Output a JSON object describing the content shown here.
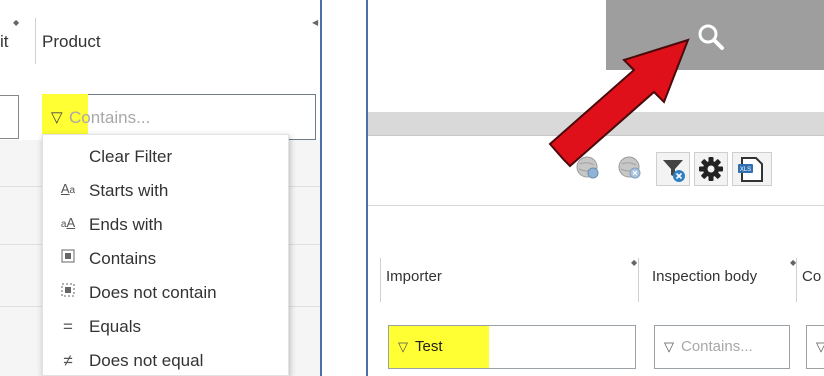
{
  "left": {
    "prev_column_label": "it",
    "column_header": "Product",
    "filter": {
      "placeholder": "Contains...",
      "funnel_icon": "filter-icon"
    },
    "menu": {
      "items": [
        {
          "label": "Clear Filter",
          "icon": ""
        },
        {
          "label": "Starts with",
          "icon": "starts-with-icon"
        },
        {
          "label": "Ends with",
          "icon": "ends-with-icon"
        },
        {
          "label": "Contains",
          "icon": "contains-icon"
        },
        {
          "label": "Does not contain",
          "icon": "does-not-contain-icon"
        },
        {
          "label": "Equals",
          "icon": "equals-icon"
        },
        {
          "label": "Does not equal",
          "icon": "not-equal-icon"
        }
      ]
    },
    "highlight_color": "#ffff33"
  },
  "right": {
    "search_icon": "search-icon",
    "toolbar_icons": [
      "globe-add-icon",
      "globe-remove-icon",
      "clear-filter-icon",
      "gear-icon",
      "export-xls-icon"
    ],
    "columns": [
      {
        "header": "Importer",
        "filter_value": "Test",
        "filter_placeholder": ""
      },
      {
        "header": "Inspection body",
        "filter_value": "",
        "filter_placeholder": "Contains..."
      },
      {
        "header": "Co",
        "filter_value": "",
        "filter_placeholder": ""
      }
    ],
    "xls_label": "XLS",
    "arrow_color": "#e0101a"
  }
}
